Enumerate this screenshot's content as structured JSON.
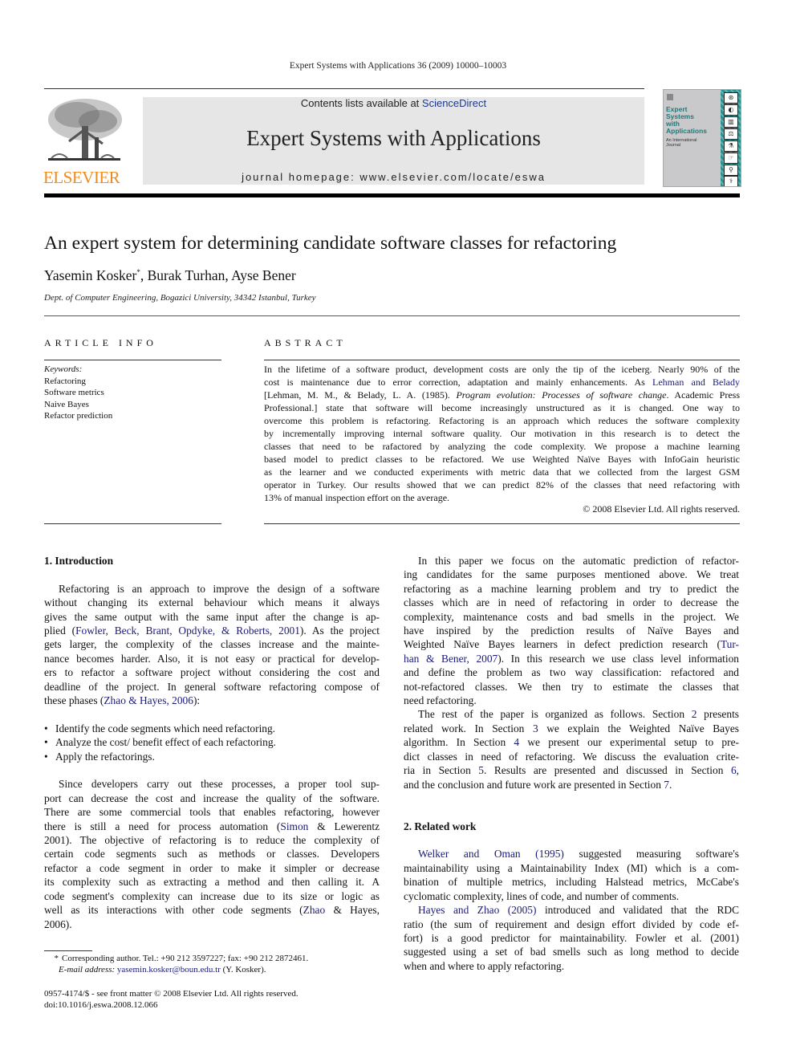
{
  "running_head": "Expert Systems with Applications 36 (2009) 10000–10003",
  "masthead": {
    "publisher_logo": "ELSEVIER",
    "contents_prefix": "Contents lists available at ",
    "contents_link": "ScienceDirect",
    "journal_title": "Expert Systems with Applications",
    "homepage": "journal homepage: www.elsevier.com/locate/eswa",
    "cover": {
      "title_lines": [
        "Expert",
        "Systems",
        "with",
        "Applications"
      ],
      "subtitle_lines": [
        "An International",
        "Journal"
      ],
      "stripe_color": "#2f8f8f"
    }
  },
  "article": {
    "title": "An expert system for determining candidate software classes for refactoring",
    "authors": [
      "Yasemin Kosker",
      "Burak Turhan",
      "Ayse Bener"
    ],
    "corresponding_mark": "*",
    "affiliation": "Dept. of Computer Engineering, Bogazici University, 34342 Istanbul, Turkey"
  },
  "article_info": {
    "heading": "ARTICLE INFO",
    "keywords_label": "Keywords:",
    "keywords": [
      "Refactoring",
      "Software metrics",
      "Naive Bayes",
      "Refactor prediction"
    ]
  },
  "abstract": {
    "heading": "ABSTRACT",
    "lines": [
      {
        "parts": [
          {
            "t": "In the lifetime of a software product, development costs are only the tip of the iceberg. Nearly 90% of the"
          }
        ]
      },
      {
        "parts": [
          {
            "t": "cost is maintenance due to error correction, adaptation and mainly enhancements. As "
          },
          {
            "t": "Lehman and Belady",
            "link": true
          }
        ]
      },
      {
        "parts": [
          {
            "t": "[Lehman, M. M., & Belady, L. A. (1985). "
          },
          {
            "t": "Program evolution: Processes of software change",
            "italic": true
          },
          {
            "t": ". Academic Press"
          }
        ]
      },
      {
        "parts": [
          {
            "t": "Professional.] state that software will become increasingly unstructured as it is changed. One way to"
          }
        ]
      },
      {
        "parts": [
          {
            "t": "overcome this problem is refactoring. Refactoring is an approach which reduces the software complexity"
          }
        ]
      },
      {
        "parts": [
          {
            "t": "by incrementally improving internal software quality. Our motivation in this research is to detect the"
          }
        ]
      },
      {
        "parts": [
          {
            "t": "classes that need to be rafactored by analyzing the code complexity. We propose a machine learning"
          }
        ]
      },
      {
        "parts": [
          {
            "t": "based model to predict classes to be refactored. We use Weighted Naïve Bayes with InfoGain heuristic"
          }
        ]
      },
      {
        "parts": [
          {
            "t": "as the learner and we conducted experiments with metric data that we collected from the largest GSM"
          }
        ]
      },
      {
        "parts": [
          {
            "t": "operator in Turkey. Our results showed that we can predict 82% of the classes that need refactoring with"
          }
        ]
      },
      {
        "parts": [
          {
            "t": "13% of manual inspection effort on the average."
          }
        ],
        "last": true
      }
    ],
    "copyright": "© 2008 Elsevier Ltd. All rights reserved."
  },
  "sections": {
    "intro": {
      "heading": "1. Introduction",
      "para1": [
        {
          "parts": [
            {
              "t": "Refactoring is an approach to improve the design of a software"
            }
          ],
          "indent": true
        },
        {
          "parts": [
            {
              "t": "without changing its external behaviour which means it always"
            }
          ]
        },
        {
          "parts": [
            {
              "t": "gives the same output with the same input after the change is ap-"
            }
          ]
        },
        {
          "parts": [
            {
              "t": "plied ("
            },
            {
              "t": "Fowler, Beck, Brant, Opdyke, & Roberts, 2001",
              "link": true
            },
            {
              "t": "). As the project"
            }
          ]
        },
        {
          "parts": [
            {
              "t": "gets larger, the complexity of the classes increase and the mainte-"
            }
          ]
        },
        {
          "parts": [
            {
              "t": "nance becomes harder. Also, it is not easy or practical for develop-"
            }
          ]
        },
        {
          "parts": [
            {
              "t": "ers to refactor a software project without considering the cost and"
            }
          ]
        },
        {
          "parts": [
            {
              "t": "deadline of the project. In general software refactoring compose of"
            }
          ]
        },
        {
          "parts": [
            {
              "t": "these phases ("
            },
            {
              "t": "Zhao & Hayes, 2006",
              "link": true
            },
            {
              "t": "):"
            }
          ],
          "last": true
        }
      ],
      "bullets": [
        "Identify the code segments which need refactoring.",
        "Analyze the cost/ benefit effect of each refactoring.",
        "Apply the refactorings."
      ],
      "para2": [
        {
          "parts": [
            {
              "t": "Since developers carry out these processes, a proper tool sup-"
            }
          ],
          "indent": true
        },
        {
          "parts": [
            {
              "t": "port can decrease the cost and increase the quality of the software."
            }
          ]
        },
        {
          "parts": [
            {
              "t": "There are some commercial tools that enables refactoring, however"
            }
          ]
        },
        {
          "parts": [
            {
              "t": "there is still a need for process automation ("
            },
            {
              "t": "Simon",
              "link": true
            },
            {
              "t": " & Lewerentz"
            }
          ]
        },
        {
          "parts": [
            {
              "t": "2001). The objective of refactoring is to reduce the complexity of"
            }
          ]
        },
        {
          "parts": [
            {
              "t": "certain code segments such as methods or classes. Developers"
            }
          ]
        },
        {
          "parts": [
            {
              "t": "refactor a code segment in order to make it simpler or decrease"
            }
          ]
        },
        {
          "parts": [
            {
              "t": "its complexity such as extracting a method and then calling it. A"
            }
          ]
        },
        {
          "parts": [
            {
              "t": "code segment's complexity can increase due to its size or logic as"
            }
          ]
        },
        {
          "parts": [
            {
              "t": "well as its interactions with other code segments ("
            },
            {
              "t": "Zhao",
              "link": true
            },
            {
              "t": " & Hayes,"
            }
          ]
        },
        {
          "parts": [
            {
              "t": "2006)."
            }
          ],
          "last": true
        }
      ],
      "para3": [
        {
          "parts": [
            {
              "t": "In this paper we focus on the automatic prediction of refactor-"
            }
          ],
          "indent": true
        },
        {
          "parts": [
            {
              "t": "ing candidates for the same purposes mentioned above. We treat"
            }
          ]
        },
        {
          "parts": [
            {
              "t": "refactoring as a machine learning problem and try to predict the"
            }
          ]
        },
        {
          "parts": [
            {
              "t": "classes which are in need of refactoring in order to decrease the"
            }
          ]
        },
        {
          "parts": [
            {
              "t": "complexity, maintenance costs and bad smells in the project. We"
            }
          ]
        },
        {
          "parts": [
            {
              "t": "have inspired by the prediction results of Naïve Bayes and"
            }
          ]
        },
        {
          "parts": [
            {
              "t": "Weighted Naïve Bayes learners in defect prediction research ("
            },
            {
              "t": "Tur-",
              "link": true
            }
          ]
        },
        {
          "parts": [
            {
              "t": "han & Bener, 2007",
              "link": true
            },
            {
              "t": "). In this research we use class level information"
            }
          ]
        },
        {
          "parts": [
            {
              "t": "and define the problem as two way classification: refactored and"
            }
          ]
        },
        {
          "parts": [
            {
              "t": "not-refactored classes. We then try to estimate the classes that"
            }
          ]
        },
        {
          "parts": [
            {
              "t": "need refactoring."
            }
          ],
          "last": true
        }
      ],
      "para4": [
        {
          "parts": [
            {
              "t": "The rest of the paper is organized as follows. Section "
            },
            {
              "t": "2",
              "link": true
            },
            {
              "t": " presents"
            }
          ],
          "indent": true
        },
        {
          "parts": [
            {
              "t": "related work. In Section "
            },
            {
              "t": "3",
              "link": true
            },
            {
              "t": " we explain the Weighted Naïve Bayes"
            }
          ]
        },
        {
          "parts": [
            {
              "t": "algorithm. In Section "
            },
            {
              "t": "4",
              "link": true
            },
            {
              "t": " we present our experimental setup to pre-"
            }
          ]
        },
        {
          "parts": [
            {
              "t": "dict classes in need of refactoring. We discuss the evaluation crite-"
            }
          ]
        },
        {
          "parts": [
            {
              "t": "ria in Section "
            },
            {
              "t": "5",
              "link": true
            },
            {
              "t": ". Results are presented and discussed in Section "
            },
            {
              "t": "6",
              "link": true
            },
            {
              "t": ","
            }
          ]
        },
        {
          "parts": [
            {
              "t": "and the conclusion and future work are presented in Section "
            },
            {
              "t": "7",
              "link": true
            },
            {
              "t": "."
            }
          ],
          "last": true
        }
      ]
    },
    "related": {
      "heading": "2. Related work",
      "para1": [
        {
          "parts": [
            {
              "t": "Welker  and Oman (1995)",
              "link": true
            },
            {
              "t": " suggested measuring software's"
            }
          ],
          "indent": true
        },
        {
          "parts": [
            {
              "t": "maintainability using a Maintainability Index (MI) which is a com-"
            }
          ]
        },
        {
          "parts": [
            {
              "t": "bination of multiple metrics, including Halstead metrics, McCabe's"
            }
          ]
        },
        {
          "parts": [
            {
              "t": "cyclomatic complexity, lines of code, and number of comments."
            }
          ],
          "last": true
        }
      ],
      "para2": [
        {
          "parts": [
            {
              "t": "Hayes and Zhao (2005)",
              "link": true
            },
            {
              "t": " introduced and validated that the RDC"
            }
          ],
          "indent": true
        },
        {
          "parts": [
            {
              "t": "ratio (the sum of requirement and design effort divided by code ef-"
            }
          ]
        },
        {
          "parts": [
            {
              "t": "fort) is a good predictor for maintainability. Fowler et al. (2001)"
            }
          ]
        },
        {
          "parts": [
            {
              "t": "suggested using a set of bad smells such as long method to decide"
            }
          ]
        },
        {
          "parts": [
            {
              "t": "when and where to apply refactoring."
            }
          ],
          "last": true
        }
      ]
    }
  },
  "footnote": {
    "mark": "*",
    "text": "Corresponding author. Tel.: +90 212 3597227; fax: +90 212 2872461.",
    "email_label": "E-mail address:",
    "email": "yasemin.kosker@boun.edu.tr",
    "email_suffix": " (Y. Kosker)."
  },
  "front_matter": {
    "issn_line": "0957-4174/$ - see front matter © 2008 Elsevier Ltd. All rights reserved.",
    "doi": "doi:10.1016/j.eswa.2008.12.066"
  },
  "colors": {
    "link": "#1a1a7a",
    "elsevier_orange": "#f08a1c",
    "sciencedirect_blue": "#1b3a8f",
    "masthead_bg": "#e6e6e6"
  }
}
